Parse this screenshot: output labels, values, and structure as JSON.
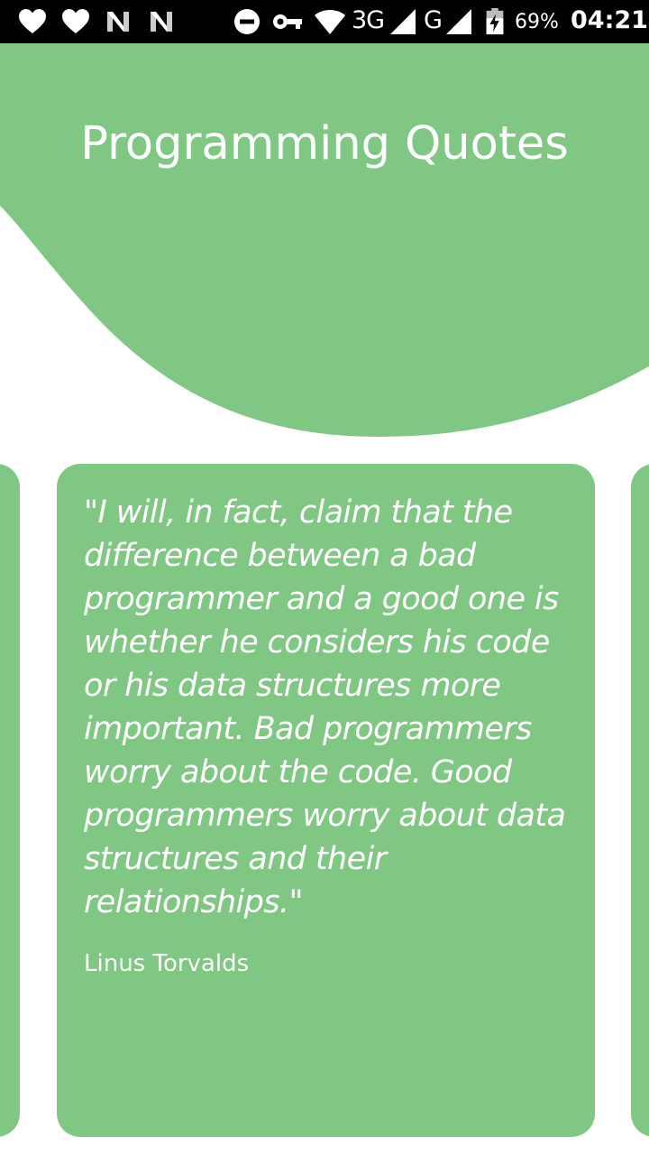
{
  "status_bar": {
    "icons": [
      "heart-icon",
      "heart-icon",
      "n-notification-icon",
      "n-notification-icon",
      "do-not-disturb-icon",
      "vpn-key-icon",
      "wifi-icon",
      "signal-icon",
      "signal-icon",
      "battery-charging-icon"
    ],
    "network_1": "3G",
    "network_2": "G",
    "battery": "69%",
    "time": "04:21"
  },
  "header": {
    "title": "Programming Quotes"
  },
  "quote": {
    "text": "\"I will, in fact, claim that the difference between a bad programmer and a good one is whether he considers his code or his data structures more important. Bad programmers worry about the code. Good programmers worry about data structures and their relationships.\"",
    "author": "Linus Torvalds"
  },
  "colors": {
    "accent": "#81c784",
    "status_bar": "#000000",
    "text_on_accent": "#ffffff",
    "background": "#ffffff"
  }
}
